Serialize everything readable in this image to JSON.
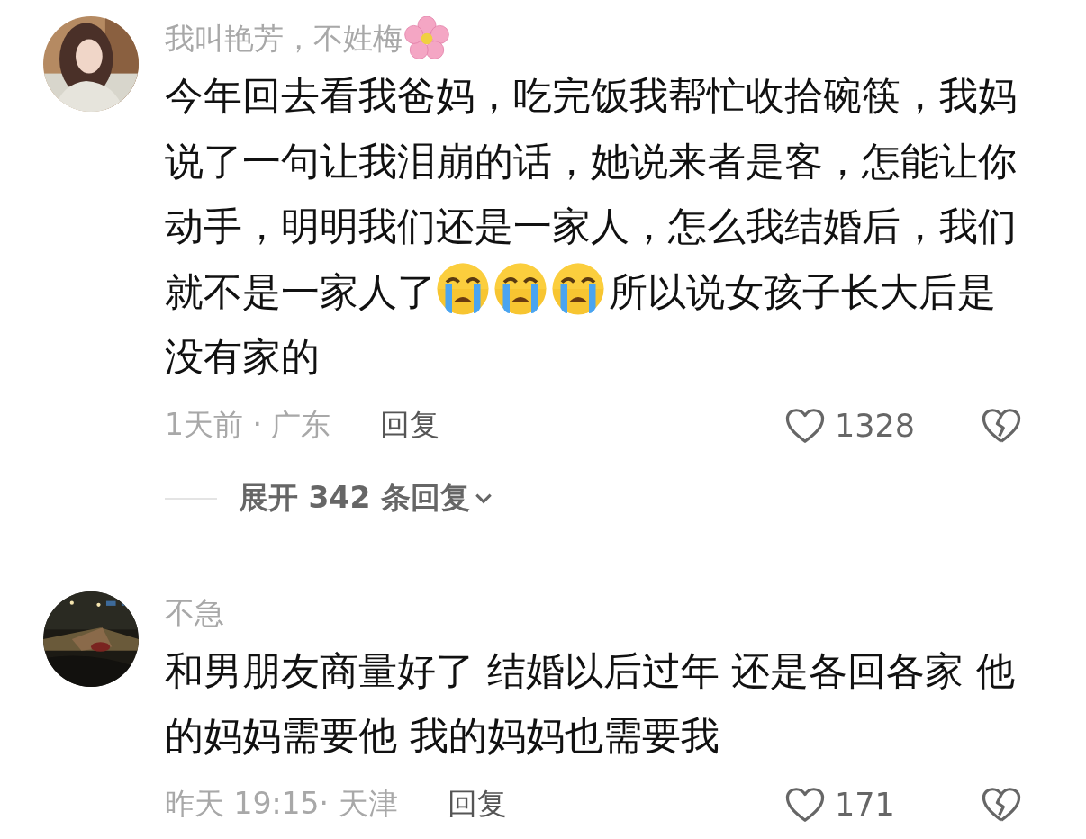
{
  "comments": [
    {
      "author": "我叫艳芳，不姓梅",
      "author_flower": true,
      "body": [
        {
          "kind": "text",
          "text": "今年回去看我爸妈，吃完饭我帮忙收拾碗筷，我妈说了一句让我泪崩的话，她说来者是客，怎能让你动手，明明我们还是一家人，怎么我结婚后，我们就不是一家人了"
        },
        {
          "kind": "emoji"
        },
        {
          "kind": "emoji"
        },
        {
          "kind": "emoji"
        },
        {
          "kind": "text",
          "text": "所以说女孩子长大后是没有家的"
        }
      ],
      "meta": "1天前 · 广东",
      "reply_label": "回复",
      "likes": "1328",
      "expand": {
        "label": "展开 342 条回复"
      }
    },
    {
      "author": "不急",
      "body": [
        {
          "kind": "text",
          "text": "和男朋友商量好了 结婚以后过年 还是各回各家 他的妈妈需要他 我的妈妈也需要我"
        }
      ],
      "meta": "昨天 19:15· 天津",
      "reply_label": "回复",
      "likes": "171"
    }
  ]
}
